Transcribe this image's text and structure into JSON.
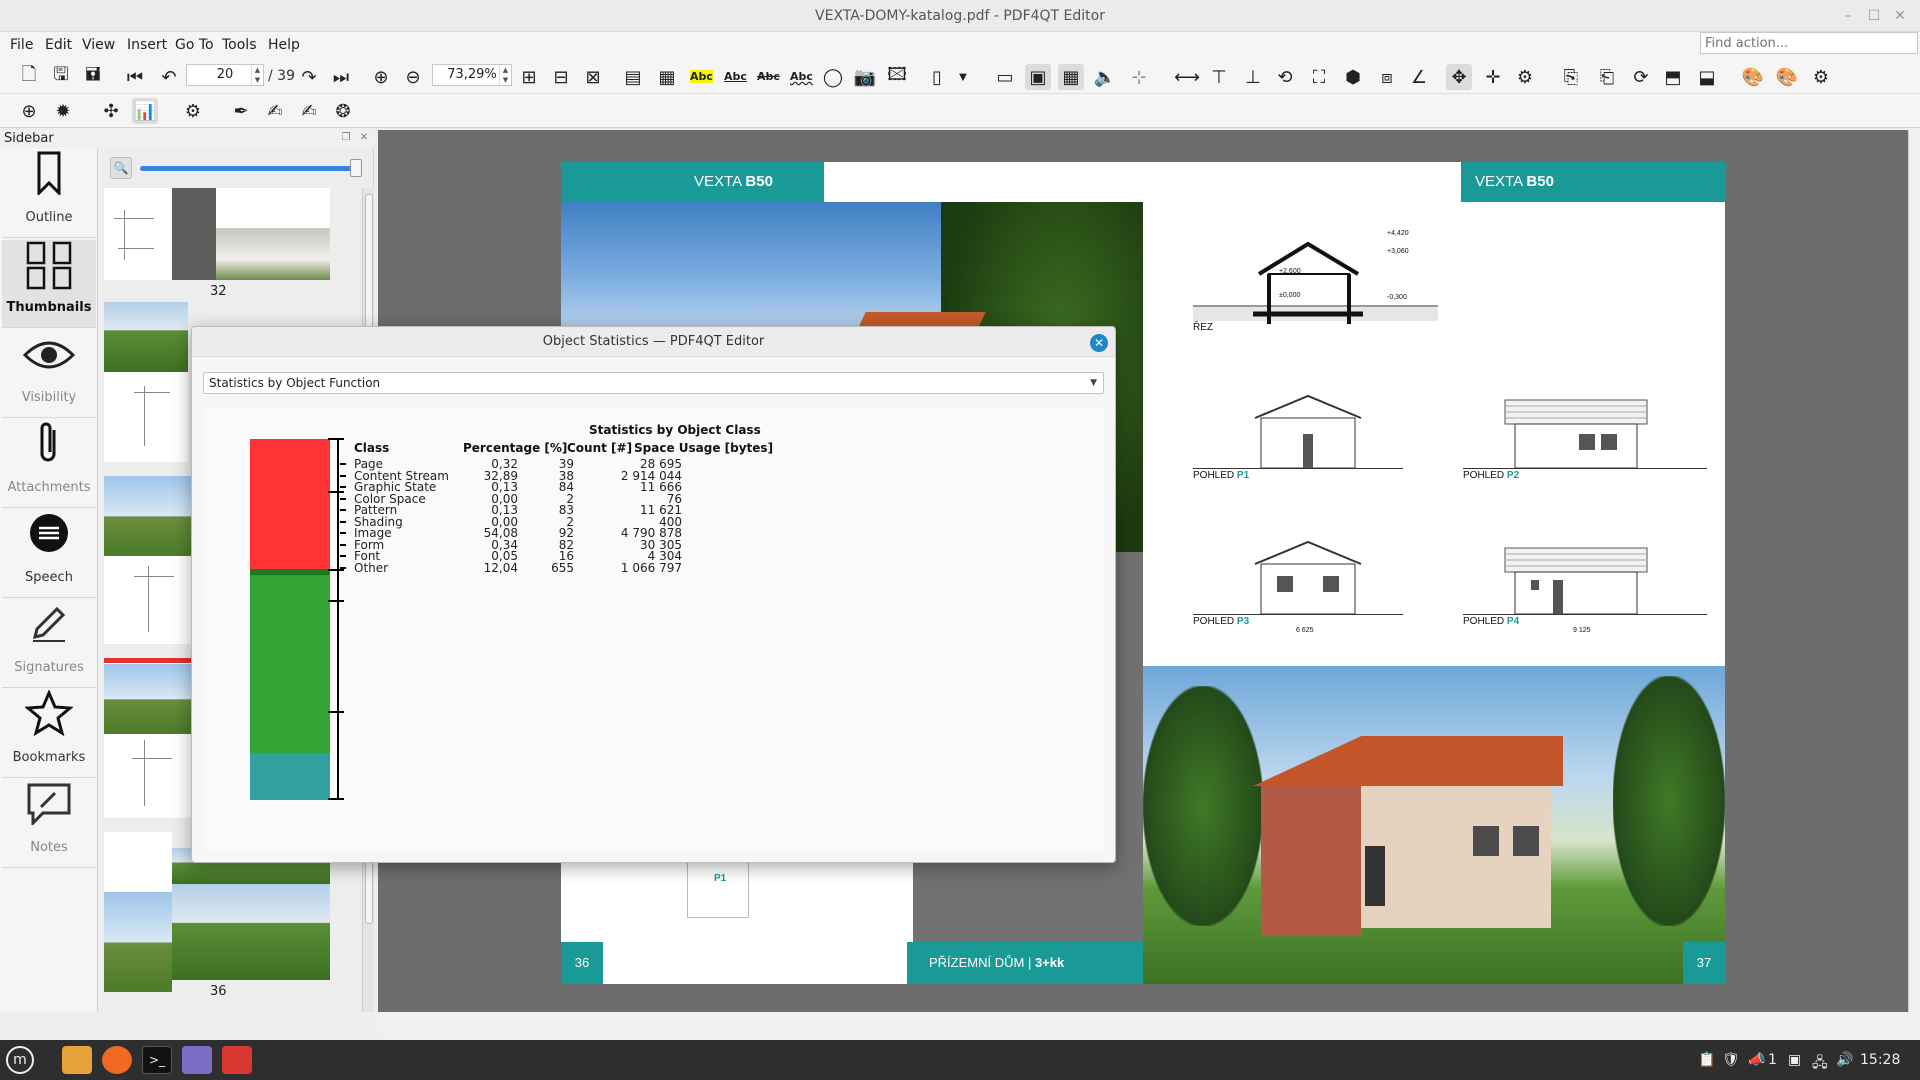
{
  "window": {
    "title": "VEXTA-DOMY-katalog.pdf - PDF4QT Editor"
  },
  "menu": [
    "File",
    "Edit",
    "View",
    "Insert",
    "Go To",
    "Tools",
    "Help"
  ],
  "find_action": {
    "placeholder": "Find action..."
  },
  "toolbar": {
    "page_current": "20",
    "page_total": "/ 39",
    "zoom": "73,29%",
    "abc_highlight": "Abc",
    "abc_underline": "Abc",
    "abc_strike": "Abc",
    "abc_squiggle": "Abc"
  },
  "sidebar": {
    "title": "Sidebar",
    "tabs": [
      {
        "label": "Outline",
        "icon": "bookmark-icon"
      },
      {
        "label": "Thumbnails",
        "icon": "thumbnails-icon"
      },
      {
        "label": "Visibility",
        "icon": "eye-icon"
      },
      {
        "label": "Attachments",
        "icon": "paperclip-icon"
      },
      {
        "label": "Speech",
        "icon": "speech-icon"
      },
      {
        "label": "Signatures",
        "icon": "pen-icon"
      },
      {
        "label": "Bookmarks",
        "icon": "star-icon"
      },
      {
        "label": "Notes",
        "icon": "note-icon"
      }
    ],
    "thumb_numbers": [
      "32",
      "36"
    ]
  },
  "document": {
    "left_page": {
      "banner_prefix": "VEXTA ",
      "banner_bold": "B50",
      "page_number": "36",
      "footer_prefix": "PŘÍZEMNÍ DŮM | ",
      "footer_bold": "3+kk",
      "plan_label": "P1"
    },
    "right_page": {
      "banner_prefix": "VEXTA ",
      "banner_bold": "B50",
      "page_number": "37",
      "section_label": "ŘEZ",
      "section_levels": [
        "+4,420",
        "+3,060",
        "+2,600",
        "±0,000",
        "-0,300"
      ],
      "view_prefix": "POHLED ",
      "views": [
        "P1",
        "P2",
        "P3",
        "P4"
      ],
      "dimension_p3": "6 625",
      "dimension_p4": "9 125"
    }
  },
  "dialog": {
    "title": "Object Statistics — PDF4QT Editor",
    "select_value": "Statistics by Object Function",
    "heading": "Statistics by Object Class",
    "columns": [
      "Class",
      "Percentage [%]",
      "Count [#]",
      "Space Usage [bytes]"
    ],
    "rows": [
      {
        "class": "Page",
        "percentage": "0,32",
        "count": "39",
        "space": "28 695"
      },
      {
        "class": "Content Stream",
        "percentage": "32,89",
        "count": "38",
        "space": "2 914 044"
      },
      {
        "class": "Graphic State",
        "percentage": "0,13",
        "count": "84",
        "space": "11 666"
      },
      {
        "class": "Color Space",
        "percentage": "0,00",
        "count": "2",
        "space": "76"
      },
      {
        "class": "Pattern",
        "percentage": "0,13",
        "count": "83",
        "space": "11 621"
      },
      {
        "class": "Shading",
        "percentage": "0,00",
        "count": "2",
        "space": "400"
      },
      {
        "class": "Image",
        "percentage": "54,08",
        "count": "92",
        "space": "4 790 878"
      },
      {
        "class": "Form",
        "percentage": "0,34",
        "count": "82",
        "space": "30 305"
      },
      {
        "class": "Font",
        "percentage": "0,05",
        "count": "16",
        "space": "4 304"
      },
      {
        "class": "Other",
        "percentage": "12,04",
        "count": "655",
        "space": "1 066 797"
      }
    ],
    "bar_colors": {
      "content_stream": "#ff3333",
      "image": "#33a333",
      "other": "#33a0a0",
      "divider": "#1e7a1e"
    }
  },
  "taskbar": {
    "apps": [
      "mint-menu-icon",
      "files-icon",
      "firefox-icon",
      "terminal-icon",
      "text-editor-icon",
      "pdf4qt-icon"
    ],
    "notification_count": "1",
    "clock": "15:28"
  }
}
